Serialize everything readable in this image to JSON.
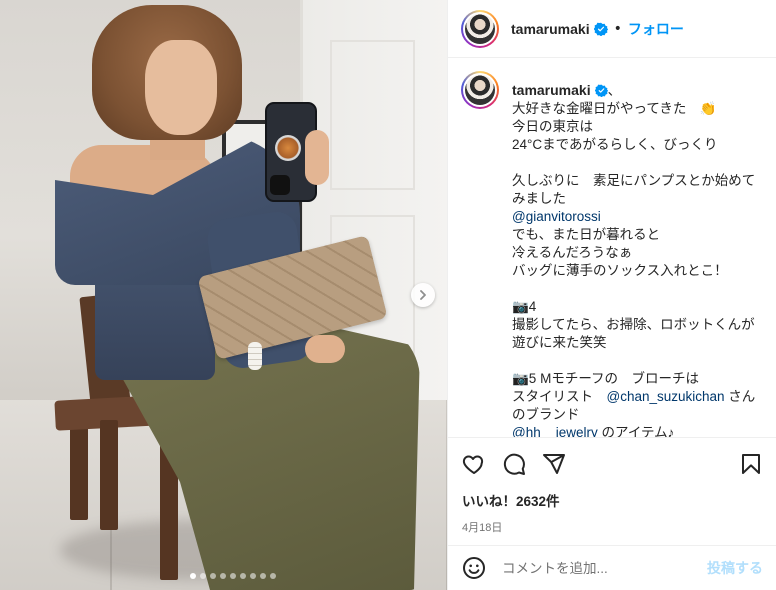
{
  "post": {
    "username": "tamarumaki",
    "follow_label": "フォロー",
    "separator": "•",
    "caption_suffix": "、",
    "caption_lines": [
      "大好きな金曜日がやってきた　👏",
      "今日の東京は",
      "24°Cまであがるらしく、びっくり",
      "",
      "久しぶりに　素足にパンプスとか始めてみました",
      "@gianvitorossi",
      "でも、また日が暮れると",
      "冷えるんだろうなぁ",
      "バッグに薄手のソックス入れとこ！",
      "",
      "📷4",
      "撮影してたら、お掃除、ロボットくんが遊びに来た笑笑",
      "",
      "📷5 Mモチーフの　ブローチは",
      "スタイリスト　@chan_suzukichan さんのブランド",
      "@hh__jewelry のアイテム♪"
    ],
    "likes": "いいね！2632件",
    "date": "4月18日",
    "comment_placeholder": "コメントを追加...",
    "post_label": "投稿する",
    "carousel": {
      "total": 9,
      "active_index": 0
    }
  },
  "colors": {
    "accent": "#0095f6",
    "mention": "#00376b",
    "muted": "#737373",
    "post_disabled": "#b2dffc"
  },
  "icons": [
    "verified-badge-icon",
    "heart-icon",
    "comment-icon",
    "share-icon",
    "bookmark-icon",
    "emoji-icon",
    "chevron-right-icon"
  ]
}
